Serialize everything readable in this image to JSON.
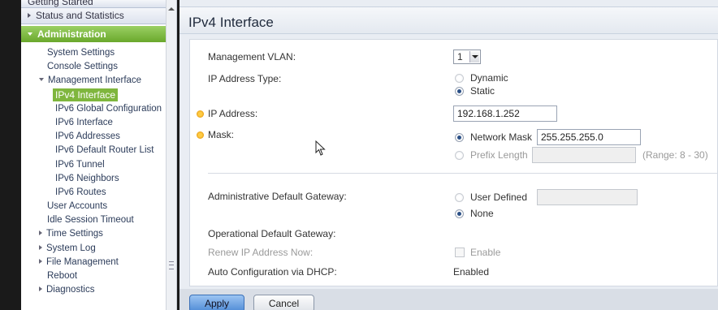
{
  "sidebar": {
    "headers": {
      "getting_started": "Getting Started",
      "status_and_statistics": "Status and Statistics",
      "administration": "Administration"
    },
    "items": [
      {
        "label": "System Settings",
        "level": 1,
        "selected": false
      },
      {
        "label": "Console Settings",
        "level": 1,
        "selected": false
      },
      {
        "label": "Management Interface",
        "level": 1,
        "expanded": true
      },
      {
        "label": "IPv4 Interface",
        "level": 2,
        "selected": true
      },
      {
        "label": "IPv6 Global Configuration",
        "level": 2
      },
      {
        "label": "IPv6 Interface",
        "level": 2
      },
      {
        "label": "IPv6 Addresses",
        "level": 2
      },
      {
        "label": "IPv6 Default Router List",
        "level": 2
      },
      {
        "label": "IPv6 Tunnel",
        "level": 2
      },
      {
        "label": "IPv6 Neighbors",
        "level": 2
      },
      {
        "label": "IPv6 Routes",
        "level": 2
      },
      {
        "label": "User Accounts",
        "level": 1
      },
      {
        "label": "Idle Session Timeout",
        "level": 1
      },
      {
        "label": "Time Settings",
        "level": 1,
        "collapsed": true
      },
      {
        "label": "System Log",
        "level": 1,
        "collapsed": true
      },
      {
        "label": "File Management",
        "level": 1,
        "collapsed": true
      },
      {
        "label": "Reboot",
        "level": 1
      },
      {
        "label": "Diagnostics",
        "level": 1,
        "collapsed": true
      }
    ]
  },
  "page": {
    "title": "IPv4 Interface"
  },
  "form": {
    "management_vlan_label": "Management VLAN:",
    "management_vlan_value": "1",
    "ip_address_type_label": "IP Address Type:",
    "ip_type_dynamic": "Dynamic",
    "ip_type_static": "Static",
    "ip_address_label": "IP Address:",
    "ip_address_value": "192.168.1.252",
    "mask_label": "Mask:",
    "network_mask_label": "Network Mask",
    "network_mask_value": "255.255.255.0",
    "prefix_length_label": "Prefix Length",
    "prefix_range": "(Range: 8 - 30)",
    "admin_gateway_label": "Administrative Default Gateway:",
    "user_defined_label": "User Defined",
    "none_label": "None",
    "oper_gateway_label": "Operational Default Gateway:",
    "renew_label": "Renew IP Address Now:",
    "enable_label": "Enable",
    "auto_config_label": "Auto Configuration via DHCP:",
    "auto_config_value": "Enabled"
  },
  "buttons": {
    "apply": "Apply",
    "cancel": "Cancel"
  },
  "colors": {
    "accent_green": "#7fb63d",
    "apply_blue": "#4f8bd6"
  }
}
